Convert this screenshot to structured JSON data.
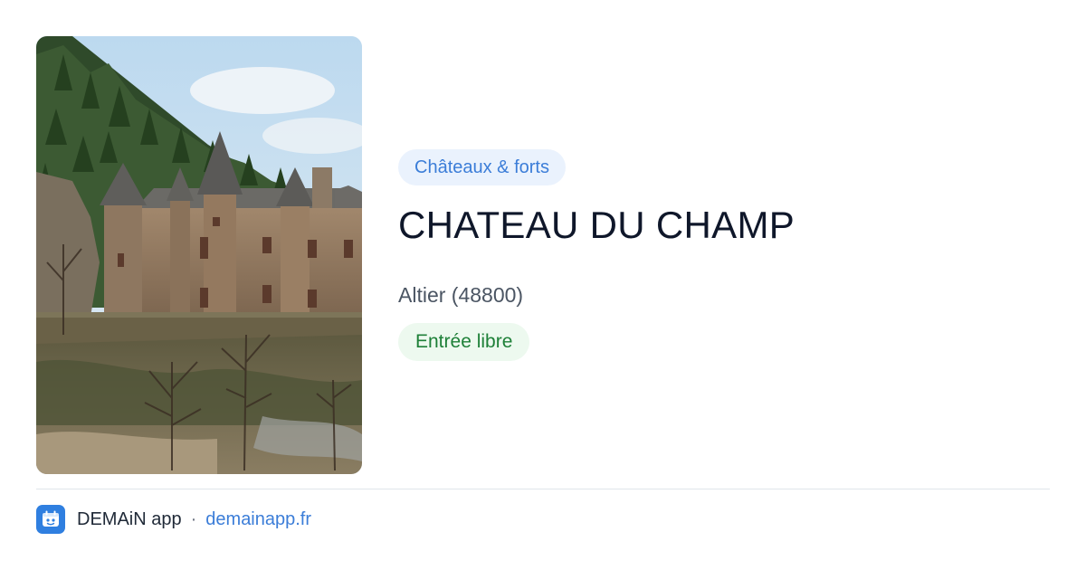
{
  "place": {
    "category": "Châteaux & forts",
    "name": "CHATEAU DU CHAMP",
    "location": "Altier (48800)",
    "access": "Entrée libre"
  },
  "footer": {
    "app_name": "DEMAiN app",
    "separator": "·",
    "url": "demainapp.fr"
  },
  "colors": {
    "category_chip_bg": "#eaf2fd",
    "category_chip_text": "#3b7dd8",
    "access_chip_bg": "#edf9ef",
    "access_chip_text": "#1e8038",
    "logo_bg": "#2f7fe0",
    "link": "#3b7dd8"
  },
  "icons": {
    "app_logo": "demain-logo-icon"
  }
}
